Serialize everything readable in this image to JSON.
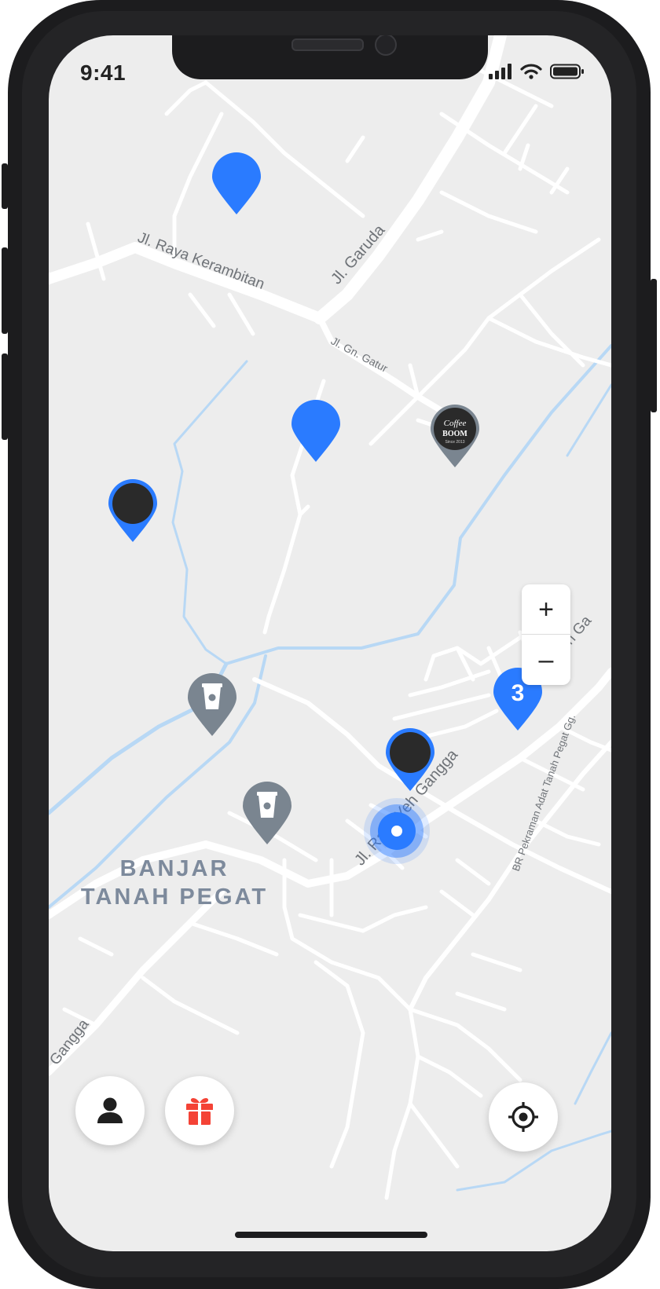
{
  "status_bar": {
    "time": "9:41"
  },
  "map": {
    "street_labels": [
      "Jl. Raya Kerambitan",
      "Jl. Garuda",
      "Jl. Gn. Gatur",
      "Jl. Raya Yeh Gangga",
      "Raya Yeh Ga",
      "BR Pekraman Adat Tanah Pegat Gg.",
      "Gangga"
    ],
    "area_label": {
      "line1": "BANJAR",
      "line2": "TANAH PEGAT"
    },
    "cluster_count": "3",
    "coffee_logo": {
      "line1": "Coffee",
      "line2": "BOOM",
      "line3": "Since 2013"
    }
  },
  "zoom": {
    "in_label": "+",
    "out_label": "–"
  },
  "colors": {
    "accent": "#2a7bff",
    "grey_pin": "#7a8590",
    "dark_pin": "#2a2a2a",
    "water": "#b8d8f5",
    "road": "#ffffff",
    "land": "#ededed",
    "gift": "#f44336"
  },
  "icons": {
    "profile": "person-icon",
    "rewards": "gift-icon",
    "locate": "crosshair-icon"
  }
}
